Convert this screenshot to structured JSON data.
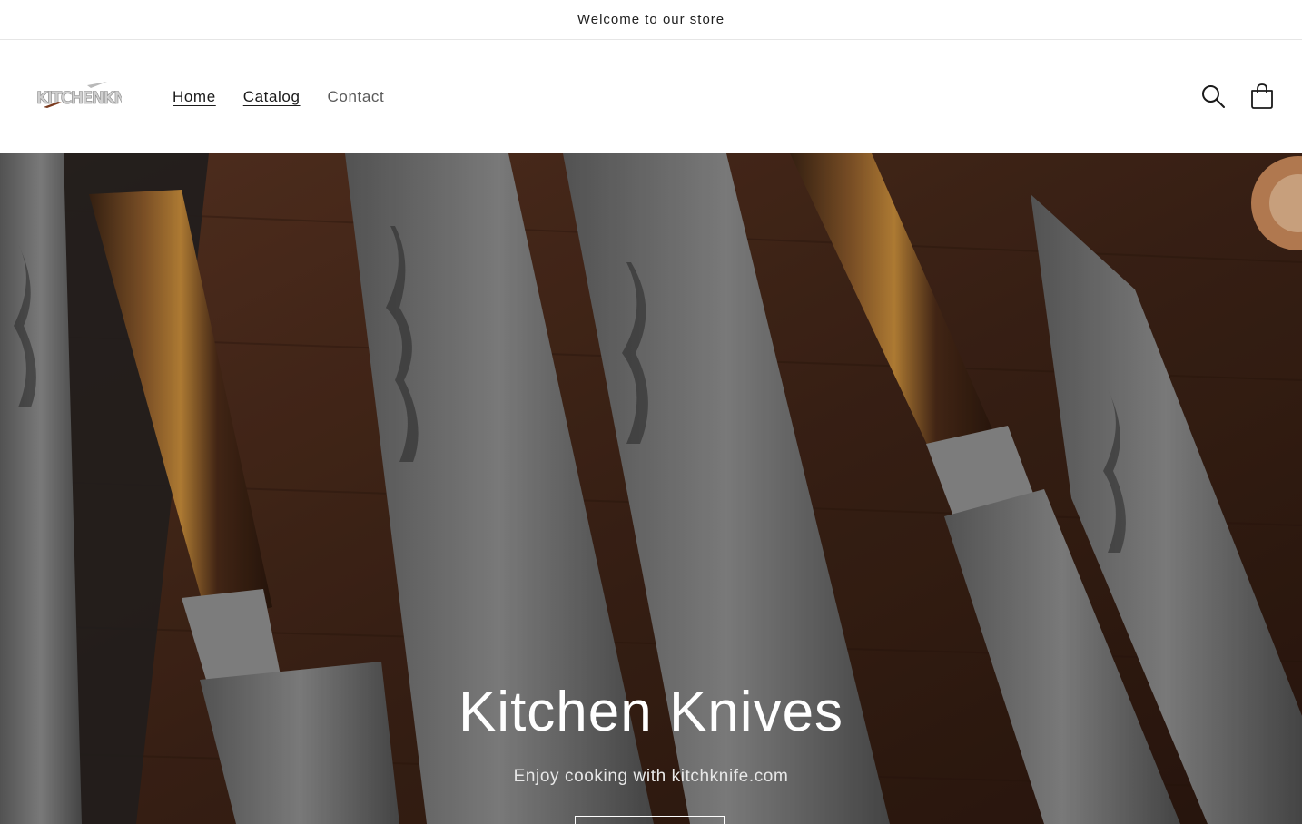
{
  "announcement": {
    "text": "Welcome to our store"
  },
  "header": {
    "logo_text": "KITCHENKNIFE",
    "nav": [
      {
        "label": "Home"
      },
      {
        "label": "Catalog"
      },
      {
        "label": "Contact"
      }
    ],
    "icons": {
      "search": "search-icon",
      "cart": "cart-icon"
    }
  },
  "hero": {
    "title": "Kitchen Knives",
    "subtitle": "Enjoy cooking with kitchknife.com",
    "button_label": ""
  },
  "colors": {
    "accent_text": "#121212",
    "hero_text": "#ffffff",
    "wood_dark": "#3a2418",
    "wood_mid": "#5b3422"
  }
}
